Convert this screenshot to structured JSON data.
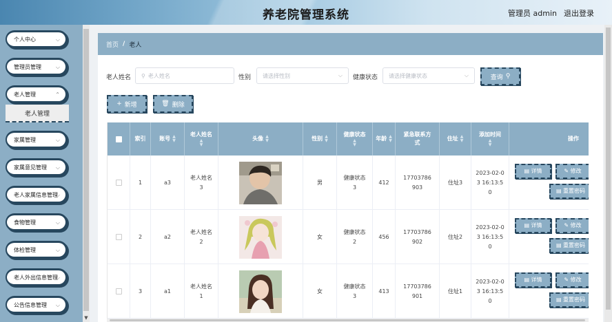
{
  "header": {
    "title": "养老院管理系统",
    "admin": "管理员 admin",
    "logout": "退出登录"
  },
  "sidebar": {
    "items": [
      {
        "label": "个人中心"
      },
      {
        "label": "管理员管理"
      },
      {
        "label": "老人管理"
      },
      {
        "label": "家属管理"
      },
      {
        "label": "家属意见管理"
      },
      {
        "label": "老人家属信息管理"
      },
      {
        "label": "食物管理"
      },
      {
        "label": "体检管理"
      },
      {
        "label": "老人外出信息管理"
      },
      {
        "label": "公告信息管理"
      }
    ],
    "active_sub": "老人管理"
  },
  "breadcrumb": {
    "home": "首页",
    "current": "老人"
  },
  "search": {
    "name_label": "老人姓名",
    "name_placeholder": "老人姓名",
    "gender_label": "性别",
    "gender_placeholder": "请选择性别",
    "health_label": "健康状态",
    "health_placeholder": "请选择健康状态",
    "query_button": "查询"
  },
  "actions": {
    "add": "新增",
    "delete": "删除"
  },
  "table": {
    "headers": {
      "index": "索引",
      "account": "账号",
      "name": "老人姓名",
      "avatar": "头像",
      "gender": "性别",
      "health": "健康状态",
      "age": "年龄",
      "phone": "紧急联系方式",
      "address": "住址",
      "added": "添加时间",
      "ops": "操作"
    },
    "rows": [
      {
        "index": "1",
        "account": "a3",
        "name": "老人姓名3",
        "gender": "男",
        "health": "健康状态3",
        "age": "412",
        "phone": "17703786903",
        "address": "住址3",
        "added": "2023-02-03 16:13:50"
      },
      {
        "index": "2",
        "account": "a2",
        "name": "老人姓名2",
        "gender": "女",
        "health": "健康状态2",
        "age": "456",
        "phone": "17703786902",
        "address": "住址2",
        "added": "2023-02-03 16:13:50"
      },
      {
        "index": "3",
        "account": "a1",
        "name": "老人姓名1",
        "gender": "女",
        "health": "健康状态3",
        "age": "413",
        "phone": "17703786901",
        "address": "住址1",
        "added": "2023-02-03 16:13:50"
      }
    ],
    "ops": {
      "detail": "详情",
      "edit": "修改",
      "reset": "重置密码"
    }
  },
  "colors": {
    "accent": "#8caec5",
    "border": "#27475e",
    "bg": "#eef1f4"
  }
}
